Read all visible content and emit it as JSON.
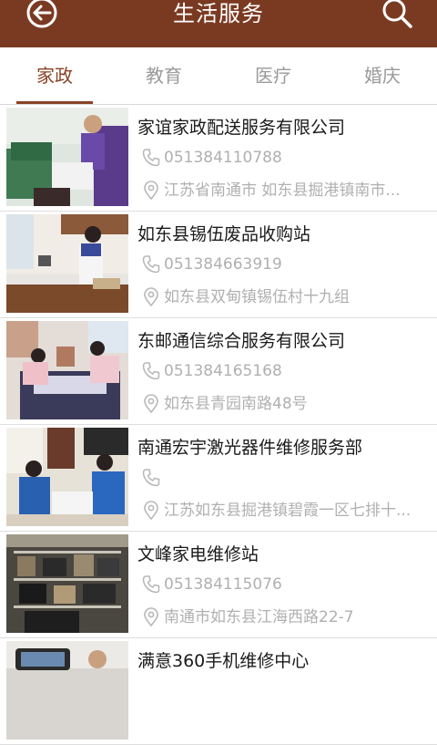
{
  "header": {
    "title": "生活服务",
    "back_icon": "back-arrow-circle-icon",
    "search_icon": "search-icon",
    "bg_color": "#7a3a22"
  },
  "tabs": [
    {
      "label": "家政",
      "active": true
    },
    {
      "label": "教育",
      "active": false
    },
    {
      "label": "医疗",
      "active": false
    },
    {
      "label": "婚庆",
      "active": false
    }
  ],
  "accent_color": "#8a4226",
  "listings": [
    {
      "name": "家谊家政配送服务有限公司",
      "phone": "051384110788",
      "address": "江苏省南通市 如东县掘港镇南市..."
    },
    {
      "name": "如东县锡伍废品收购站",
      "phone": "051384663919",
      "address": "如东县双甸镇锡伍村十九组"
    },
    {
      "name": "东邮通信综合服务有限公司",
      "phone": "051384165168",
      "address": "如东县青园南路48号"
    },
    {
      "name": "南通宏宇激光器件维修服务部",
      "phone": "",
      "address": "江苏如东县掘港镇碧霞一区七排十..."
    },
    {
      "name": "文峰家电维修站",
      "phone": "051384115076",
      "address": "南通市如东县江海西路22-7"
    },
    {
      "name": "满意360手机维修中心",
      "phone": "",
      "address": ""
    }
  ]
}
